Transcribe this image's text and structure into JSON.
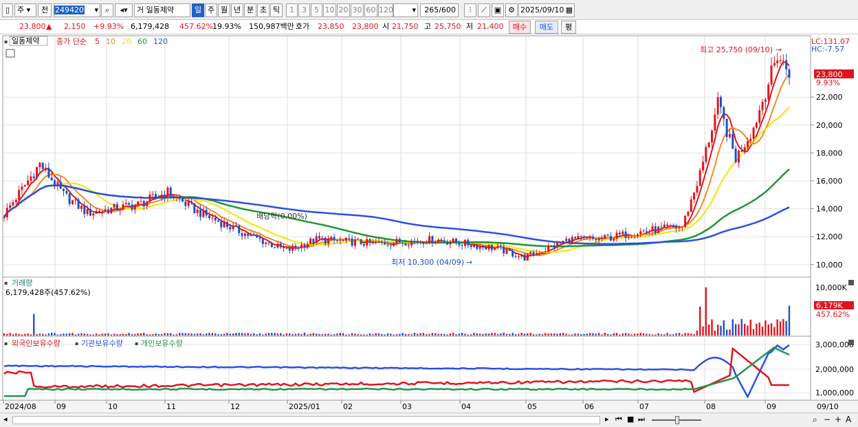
{
  "toolbar": {
    "market_label": "주",
    "prev_label": "전",
    "stock_code": "249420",
    "stock_name_prefix": "거",
    "stock_name": "일동제약",
    "periods": [
      "일",
      "주",
      "월",
      "년",
      "분",
      "초",
      "틱"
    ],
    "active_period": "일",
    "intervals": [
      "1",
      "3",
      "5",
      "10",
      "20",
      "30",
      "60",
      "120"
    ],
    "count": "265",
    "count_total": "/600",
    "date": "2025/09/10"
  },
  "info": {
    "price": "23,800",
    "change": "2,150",
    "change_pct": "+9.93%",
    "volume": "6,179,428",
    "volume_ratio": "457.62%",
    "turnover": "19.93%",
    "amount": "150,987백만",
    "quote_label": "호가",
    "ask": "23,850",
    "bid": "23,800",
    "open_label": "시",
    "open": "21,750",
    "high_label": "고",
    "high": "25,750",
    "low_label": "저",
    "low": "21,400",
    "buy_label": "매수",
    "sell_label": "매도",
    "eval_label": "평"
  },
  "price_panel": {
    "stock_tag": "일동제약",
    "legend_prefix": "종가 단순",
    "ma_periods": [
      {
        "label": "5",
        "color": "#e0141e"
      },
      {
        "label": "10",
        "color": "#f08c1e"
      },
      {
        "label": "20",
        "color": "#f0e600"
      },
      {
        "label": "60",
        "color": "#1e9632"
      },
      {
        "label": "120",
        "color": "#2850e6"
      }
    ],
    "lc": "LC:131.07",
    "hc": "HC:-7.57",
    "last_price_tag": "23,800",
    "last_pct": "9.93%",
    "y_ticks": [
      "22,000",
      "20,000",
      "18,000",
      "16,000",
      "14,000",
      "12,000",
      "10,000"
    ],
    "high_note": "최고 25,750 (09/10)",
    "low_note": "최저 10,300 (04/09)",
    "event_note": "배당락(0.00%)"
  },
  "volume_panel": {
    "title": "거래량",
    "summary": "6,179,428주(457.62%)",
    "y_top": "10,000K",
    "last_tag": "6,179K",
    "last_pct": "457.62%"
  },
  "holdings_panel": {
    "foreign_label": "외국인보유수량",
    "inst_label": "기관보유수량",
    "indiv_label": "개인보유수량",
    "foreign_color": "#e0141e",
    "inst_color": "#2850e6",
    "indiv_color": "#1e9650",
    "y_ticks": [
      "3,000,000",
      "2,000,000",
      "1,000,000"
    ]
  },
  "x_axis": {
    "labels": [
      "2024/08",
      "09",
      "10",
      "11",
      "12",
      "2025/01",
      "02",
      "03",
      "04",
      "05",
      "06",
      "07",
      "08",
      "09"
    ],
    "last_label": "09/10"
  },
  "chart_data": {
    "type": "candlestick",
    "title": "일동제약",
    "ylim": [
      9500,
      26000
    ],
    "monthly_approx_close": [
      {
        "month": "2024/08",
        "value": 16500
      },
      {
        "month": "09",
        "value": 14000
      },
      {
        "month": "10",
        "value": 14500
      },
      {
        "month": "11",
        "value": 12500
      },
      {
        "month": "12",
        "value": 11800
      },
      {
        "month": "2025/01",
        "value": 12200
      },
      {
        "month": "02",
        "value": 11500
      },
      {
        "month": "03",
        "value": 11400
      },
      {
        "month": "04",
        "value": 10800
      },
      {
        "month": "05",
        "value": 11700
      },
      {
        "month": "06",
        "value": 12600
      },
      {
        "month": "07",
        "value": 21500
      },
      {
        "month": "08",
        "value": 20500
      },
      {
        "month": "09",
        "value": 23800
      }
    ],
    "annotations": [
      "최고 25,750 (09/10)",
      "최저 10,300 (04/09)"
    ]
  }
}
